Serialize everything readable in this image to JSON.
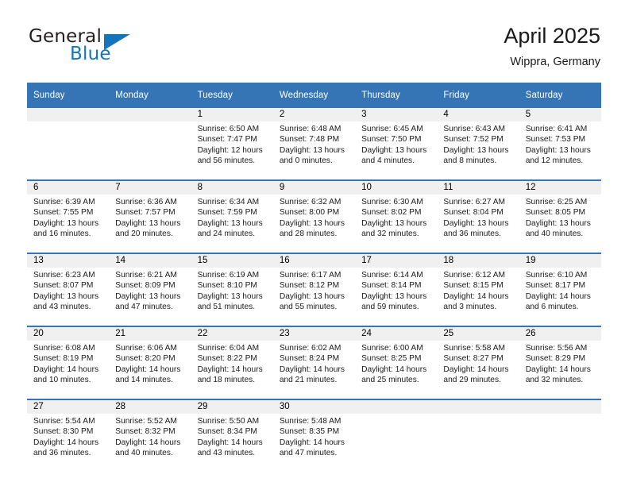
{
  "logo": {
    "word_top": "General",
    "word_bottom": "Blue",
    "triangle_color": "#1275bc",
    "text_color": "#231f20"
  },
  "header": {
    "title": "April 2025",
    "subtitle": "Wippra, Germany",
    "accent_color": "#3575b5",
    "band_color": "#f0f0f0"
  },
  "weekdays": [
    "Sunday",
    "Monday",
    "Tuesday",
    "Wednesday",
    "Thursday",
    "Friday",
    "Saturday"
  ],
  "labels": {
    "sunrise_prefix": "Sunrise:",
    "sunset_prefix": "Sunset:",
    "daylight_prefix": "Daylight:"
  },
  "weeks": [
    [
      {
        "day": "",
        "sunrise": "",
        "sunset": "",
        "daylight_line1": "",
        "daylight_line2": ""
      },
      {
        "day": "",
        "sunrise": "",
        "sunset": "",
        "daylight_line1": "",
        "daylight_line2": ""
      },
      {
        "day": "1",
        "sunrise": "Sunrise: 6:50 AM",
        "sunset": "Sunset: 7:47 PM",
        "daylight_line1": "Daylight: 12 hours",
        "daylight_line2": "and 56 minutes."
      },
      {
        "day": "2",
        "sunrise": "Sunrise: 6:48 AM",
        "sunset": "Sunset: 7:48 PM",
        "daylight_line1": "Daylight: 13 hours",
        "daylight_line2": "and 0 minutes."
      },
      {
        "day": "3",
        "sunrise": "Sunrise: 6:45 AM",
        "sunset": "Sunset: 7:50 PM",
        "daylight_line1": "Daylight: 13 hours",
        "daylight_line2": "and 4 minutes."
      },
      {
        "day": "4",
        "sunrise": "Sunrise: 6:43 AM",
        "sunset": "Sunset: 7:52 PM",
        "daylight_line1": "Daylight: 13 hours",
        "daylight_line2": "and 8 minutes."
      },
      {
        "day": "5",
        "sunrise": "Sunrise: 6:41 AM",
        "sunset": "Sunset: 7:53 PM",
        "daylight_line1": "Daylight: 13 hours",
        "daylight_line2": "and 12 minutes."
      }
    ],
    [
      {
        "day": "6",
        "sunrise": "Sunrise: 6:39 AM",
        "sunset": "Sunset: 7:55 PM",
        "daylight_line1": "Daylight: 13 hours",
        "daylight_line2": "and 16 minutes."
      },
      {
        "day": "7",
        "sunrise": "Sunrise: 6:36 AM",
        "sunset": "Sunset: 7:57 PM",
        "daylight_line1": "Daylight: 13 hours",
        "daylight_line2": "and 20 minutes."
      },
      {
        "day": "8",
        "sunrise": "Sunrise: 6:34 AM",
        "sunset": "Sunset: 7:59 PM",
        "daylight_line1": "Daylight: 13 hours",
        "daylight_line2": "and 24 minutes."
      },
      {
        "day": "9",
        "sunrise": "Sunrise: 6:32 AM",
        "sunset": "Sunset: 8:00 PM",
        "daylight_line1": "Daylight: 13 hours",
        "daylight_line2": "and 28 minutes."
      },
      {
        "day": "10",
        "sunrise": "Sunrise: 6:30 AM",
        "sunset": "Sunset: 8:02 PM",
        "daylight_line1": "Daylight: 13 hours",
        "daylight_line2": "and 32 minutes."
      },
      {
        "day": "11",
        "sunrise": "Sunrise: 6:27 AM",
        "sunset": "Sunset: 8:04 PM",
        "daylight_line1": "Daylight: 13 hours",
        "daylight_line2": "and 36 minutes."
      },
      {
        "day": "12",
        "sunrise": "Sunrise: 6:25 AM",
        "sunset": "Sunset: 8:05 PM",
        "daylight_line1": "Daylight: 13 hours",
        "daylight_line2": "and 40 minutes."
      }
    ],
    [
      {
        "day": "13",
        "sunrise": "Sunrise: 6:23 AM",
        "sunset": "Sunset: 8:07 PM",
        "daylight_line1": "Daylight: 13 hours",
        "daylight_line2": "and 43 minutes."
      },
      {
        "day": "14",
        "sunrise": "Sunrise: 6:21 AM",
        "sunset": "Sunset: 8:09 PM",
        "daylight_line1": "Daylight: 13 hours",
        "daylight_line2": "and 47 minutes."
      },
      {
        "day": "15",
        "sunrise": "Sunrise: 6:19 AM",
        "sunset": "Sunset: 8:10 PM",
        "daylight_line1": "Daylight: 13 hours",
        "daylight_line2": "and 51 minutes."
      },
      {
        "day": "16",
        "sunrise": "Sunrise: 6:17 AM",
        "sunset": "Sunset: 8:12 PM",
        "daylight_line1": "Daylight: 13 hours",
        "daylight_line2": "and 55 minutes."
      },
      {
        "day": "17",
        "sunrise": "Sunrise: 6:14 AM",
        "sunset": "Sunset: 8:14 PM",
        "daylight_line1": "Daylight: 13 hours",
        "daylight_line2": "and 59 minutes."
      },
      {
        "day": "18",
        "sunrise": "Sunrise: 6:12 AM",
        "sunset": "Sunset: 8:15 PM",
        "daylight_line1": "Daylight: 14 hours",
        "daylight_line2": "and 3 minutes."
      },
      {
        "day": "19",
        "sunrise": "Sunrise: 6:10 AM",
        "sunset": "Sunset: 8:17 PM",
        "daylight_line1": "Daylight: 14 hours",
        "daylight_line2": "and 6 minutes."
      }
    ],
    [
      {
        "day": "20",
        "sunrise": "Sunrise: 6:08 AM",
        "sunset": "Sunset: 8:19 PM",
        "daylight_line1": "Daylight: 14 hours",
        "daylight_line2": "and 10 minutes."
      },
      {
        "day": "21",
        "sunrise": "Sunrise: 6:06 AM",
        "sunset": "Sunset: 8:20 PM",
        "daylight_line1": "Daylight: 14 hours",
        "daylight_line2": "and 14 minutes."
      },
      {
        "day": "22",
        "sunrise": "Sunrise: 6:04 AM",
        "sunset": "Sunset: 8:22 PM",
        "daylight_line1": "Daylight: 14 hours",
        "daylight_line2": "and 18 minutes."
      },
      {
        "day": "23",
        "sunrise": "Sunrise: 6:02 AM",
        "sunset": "Sunset: 8:24 PM",
        "daylight_line1": "Daylight: 14 hours",
        "daylight_line2": "and 21 minutes."
      },
      {
        "day": "24",
        "sunrise": "Sunrise: 6:00 AM",
        "sunset": "Sunset: 8:25 PM",
        "daylight_line1": "Daylight: 14 hours",
        "daylight_line2": "and 25 minutes."
      },
      {
        "day": "25",
        "sunrise": "Sunrise: 5:58 AM",
        "sunset": "Sunset: 8:27 PM",
        "daylight_line1": "Daylight: 14 hours",
        "daylight_line2": "and 29 minutes."
      },
      {
        "day": "26",
        "sunrise": "Sunrise: 5:56 AM",
        "sunset": "Sunset: 8:29 PM",
        "daylight_line1": "Daylight: 14 hours",
        "daylight_line2": "and 32 minutes."
      }
    ],
    [
      {
        "day": "27",
        "sunrise": "Sunrise: 5:54 AM",
        "sunset": "Sunset: 8:30 PM",
        "daylight_line1": "Daylight: 14 hours",
        "daylight_line2": "and 36 minutes."
      },
      {
        "day": "28",
        "sunrise": "Sunrise: 5:52 AM",
        "sunset": "Sunset: 8:32 PM",
        "daylight_line1": "Daylight: 14 hours",
        "daylight_line2": "and 40 minutes."
      },
      {
        "day": "29",
        "sunrise": "Sunrise: 5:50 AM",
        "sunset": "Sunset: 8:34 PM",
        "daylight_line1": "Daylight: 14 hours",
        "daylight_line2": "and 43 minutes."
      },
      {
        "day": "30",
        "sunrise": "Sunrise: 5:48 AM",
        "sunset": "Sunset: 8:35 PM",
        "daylight_line1": "Daylight: 14 hours",
        "daylight_line2": "and 47 minutes."
      },
      {
        "day": "",
        "sunrise": "",
        "sunset": "",
        "daylight_line1": "",
        "daylight_line2": ""
      },
      {
        "day": "",
        "sunrise": "",
        "sunset": "",
        "daylight_line1": "",
        "daylight_line2": ""
      },
      {
        "day": "",
        "sunrise": "",
        "sunset": "",
        "daylight_line1": "",
        "daylight_line2": ""
      }
    ]
  ]
}
